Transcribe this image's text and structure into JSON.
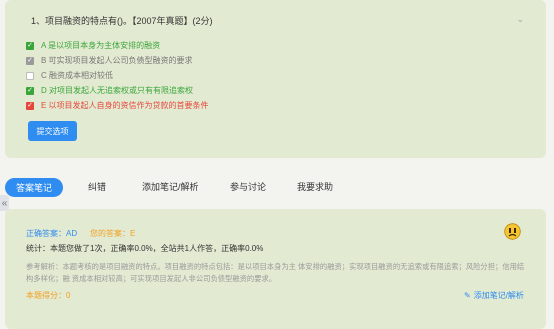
{
  "question": {
    "title": "1、项目融资的特点有()。【2007年真题】(2分)",
    "options": [
      {
        "text": "A 是以项目本身为主体安排的融资",
        "status": "correct",
        "checked": true,
        "color": "#3aa63a"
      },
      {
        "text": "B 可实现项目发起人公司负债型融资的要求",
        "status": "none",
        "checked": false,
        "color": "#777777"
      },
      {
        "text": "C 融资成本相对较低",
        "status": "none",
        "checked": false,
        "color": "#777777"
      },
      {
        "text": "D 对项目发起人无追索权或只有有限追索权",
        "status": "correct",
        "checked": true,
        "color": "#3aa63a"
      },
      {
        "text": "E 以项目发起人自身的资信作为贷款的首要条件",
        "status": "wrong",
        "checked": true,
        "color": "#e5473b"
      }
    ],
    "submit_label": "提交选项"
  },
  "tabs": [
    {
      "label": "答案笔记",
      "active": true
    },
    {
      "label": "纠错",
      "active": false
    },
    {
      "label": "添加笔记/解析",
      "active": false
    },
    {
      "label": "参与讨论",
      "active": false
    },
    {
      "label": "我要求助",
      "active": false
    }
  ],
  "answer": {
    "correct_label": "正确答案：AD",
    "your_label": "您的答案：E",
    "stats": "统计：本题您做了1次，正确率0.0%，全站共1人作答，正确率0.0%",
    "analysis": "参考解析：本题考核的是项目融资的特点。项目融资的特点包括：是以项目本身为主 体安排的融资；实现项目融资的无追索或有限追索；风险分担；信用结构多样化；融 资成本相对较高；可实现项目发起人非公司负债型融资的要求。",
    "score": "本题得分：0",
    "add_note_label": "添加笔记/解析"
  },
  "colors": {
    "accent": "#2f8cf0",
    "correct": "#3aa63a",
    "wrong": "#e5473b",
    "your_answer": "#f0a020",
    "card_bg": "#e3ead2"
  }
}
